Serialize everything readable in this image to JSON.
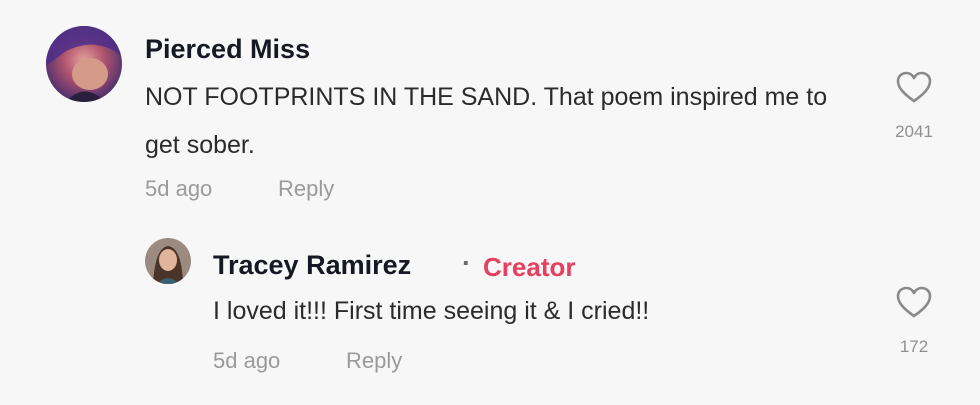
{
  "comment": {
    "username": "Pierced Miss",
    "text": "NOT FOOTPRINTS IN THE SAND. That poem inspired me to get sober.",
    "date": "5d ago",
    "reply_label": "Reply",
    "like_count": "2041",
    "avatar_icon": "user-avatar"
  },
  "reply": {
    "username": "Tracey Ramirez",
    "separator": "·",
    "badge": "Creator",
    "text": "I loved it!!! First time seeing it & I cried!!",
    "date": "5d ago",
    "reply_label": "Reply",
    "like_count": "172",
    "avatar_icon": "user-avatar"
  },
  "colors": {
    "background": "#f7f7f7",
    "creator_badge": "#e5405f",
    "meta_text": "#9a9a9a"
  }
}
